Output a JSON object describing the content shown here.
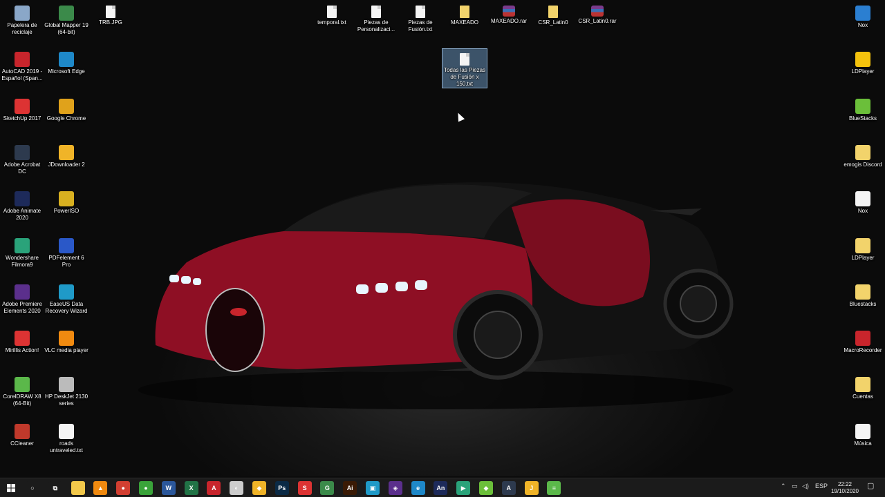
{
  "desktop": {
    "left_col1": [
      {
        "label": "Papelera de reciclaje",
        "icon": "recycle-bin-icon",
        "color": "#8aa7c8"
      },
      {
        "label": "AutoCAD 2019 - Español (Span...",
        "icon": "autocad-icon",
        "color": "#c8252c"
      },
      {
        "label": "SketchUp 2017",
        "icon": "sketchup-icon",
        "color": "#d33"
      },
      {
        "label": "Adobe Acrobat DC",
        "icon": "acrobat-icon",
        "color": "#2d3a4e"
      },
      {
        "label": "Adobe Animate 2020",
        "icon": "animate-icon",
        "color": "#1d2a5a"
      },
      {
        "label": "Wondershare Filmora9",
        "icon": "filmora-icon",
        "color": "#2aa37a"
      },
      {
        "label": "Adobe Premiere Elements 2020",
        "icon": "premiere-icon",
        "color": "#5b2f8c"
      },
      {
        "label": "Mirillis Action!",
        "icon": "action-icon",
        "color": "#d33"
      },
      {
        "label": "CorelDRAW X8 (64-Bit)",
        "icon": "coreldraw-icon",
        "color": "#5bb84a"
      },
      {
        "label": "CCleaner",
        "icon": "ccleaner-icon",
        "color": "#c0392b"
      }
    ],
    "left_col2": [
      {
        "label": "Global Mapper 19 (64-bit)",
        "icon": "global-mapper-icon",
        "color": "#3b8a4a"
      },
      {
        "label": "Microsoft Edge",
        "icon": "edge-icon",
        "color": "#1e88c8"
      },
      {
        "label": "Google Chrome",
        "icon": "chrome-icon",
        "color": "#e0a21b"
      },
      {
        "label": "JDownloader 2",
        "icon": "jdownloader-icon",
        "color": "#f0b428"
      },
      {
        "label": "PowerISO",
        "icon": "poweriso-icon",
        "color": "#d8b020"
      },
      {
        "label": "PDFelement 6 Pro",
        "icon": "pdfelement-icon",
        "color": "#2a58c8"
      },
      {
        "label": "EaseUS Data Recovery Wizard",
        "icon": "easeus-icon",
        "color": "#1f9ac8"
      },
      {
        "label": "VLC media player",
        "icon": "vlc-icon",
        "color": "#f08a10"
      },
      {
        "label": "HP DeskJet 2130 series",
        "icon": "printer-icon",
        "color": "#bbbbbb"
      },
      {
        "label": "roads untraveled.txt",
        "icon": "text-file-icon",
        "color": "#f4f4f4"
      }
    ],
    "top_files": [
      {
        "label": "TRB.JPG",
        "icon": "image-file-icon",
        "kind": "file"
      },
      {
        "label": "temporal.txt",
        "icon": "text-file-icon",
        "kind": "file"
      },
      {
        "label": "Piezas de Personalizaci...",
        "icon": "text-file-icon",
        "kind": "file"
      },
      {
        "label": "Piezas de Fusión.txt",
        "icon": "text-file-icon",
        "kind": "file"
      },
      {
        "label": "MAXEADO",
        "icon": "folder-icon",
        "kind": "folder"
      },
      {
        "label": "MAXEADO.rar",
        "icon": "rar-archive-icon",
        "kind": "rar"
      },
      {
        "label": "CSR_Latin0",
        "icon": "folder-icon",
        "kind": "folder"
      },
      {
        "label": "CSR_Latin0.rar",
        "icon": "rar-archive-icon",
        "kind": "rar"
      }
    ],
    "selected_file": {
      "label": "Todas las Piezas de Fusión x 150.txt",
      "icon": "text-file-icon"
    },
    "right_col": [
      {
        "label": "Nox",
        "icon": "nox-icon",
        "color": "#2b7fd1"
      },
      {
        "label": "LDPlayer",
        "icon": "ldplayer-icon",
        "color": "#f4c20d"
      },
      {
        "label": "BlueStacks",
        "icon": "bluestacks-icon",
        "color": "#6bbf3a"
      },
      {
        "label": "emogis Discord",
        "icon": "folder-icon",
        "color": "#f2d36b"
      },
      {
        "label": "Nox",
        "icon": "nox-shortcut-icon",
        "color": "#f4f4f4"
      },
      {
        "label": "LDPlayer",
        "icon": "ldplayer-shortcut-icon",
        "color": "#f2d36b"
      },
      {
        "label": "Bluestacks",
        "icon": "bluestacks-shortcut-icon",
        "color": "#f2d36b"
      },
      {
        "label": "MacroRecorder",
        "icon": "macrorecorder-icon",
        "color": "#c8252c"
      },
      {
        "label": "Cuentas",
        "icon": "folder-icon",
        "color": "#f2d36b"
      },
      {
        "label": "Música",
        "icon": "music-file-icon",
        "color": "#f4f4f4"
      }
    ]
  },
  "taskbar": {
    "start_icon": "windows-start-icon",
    "pinned": [
      {
        "name": "cortana-icon",
        "text": "○",
        "color": "#1b1b1b"
      },
      {
        "name": "task-view-icon",
        "text": "⧉",
        "color": "#1b1b1b"
      },
      {
        "name": "file-explorer-icon",
        "text": "",
        "color": "#f2c84b"
      },
      {
        "name": "vlc-icon",
        "text": "▲",
        "color": "#f08a10"
      },
      {
        "name": "chrome-icon",
        "text": "●",
        "color": "#d23f31"
      },
      {
        "name": "green-app-icon",
        "text": "●",
        "color": "#3aa33a"
      },
      {
        "name": "word-icon",
        "text": "W",
        "color": "#2b579a"
      },
      {
        "name": "excel-icon",
        "text": "X",
        "color": "#217346"
      },
      {
        "name": "autocad-icon",
        "text": "A",
        "color": "#c8252c"
      },
      {
        "name": "globe-app-icon",
        "text": "◐",
        "color": "#cccccc"
      },
      {
        "name": "yellow-app-icon",
        "text": "◆",
        "color": "#f0b428"
      },
      {
        "name": "photoshop-icon",
        "text": "Ps",
        "color": "#0b2a45"
      },
      {
        "name": "sketchup-icon",
        "text": "S",
        "color": "#d33"
      },
      {
        "name": "global-mapper-icon",
        "text": "G",
        "color": "#3b8a4a"
      },
      {
        "name": "illustrator-icon",
        "text": "Ai",
        "color": "#3a1a05"
      },
      {
        "name": "image-app-icon",
        "text": "▣",
        "color": "#1f9ac8"
      },
      {
        "name": "premiere-icon",
        "text": "◈",
        "color": "#5b2f8c"
      },
      {
        "name": "edge-icon",
        "text": "e",
        "color": "#1e88c8"
      },
      {
        "name": "animate-icon",
        "text": "An",
        "color": "#1d2a5a"
      },
      {
        "name": "filmora-icon",
        "text": "▶",
        "color": "#2aa37a"
      },
      {
        "name": "bluestacks-icon",
        "text": "◆",
        "color": "#6bbf3a"
      },
      {
        "name": "acrobat-icon",
        "text": "A",
        "color": "#2d3a4e"
      },
      {
        "name": "jdownloader-icon",
        "text": "J",
        "color": "#f0b428"
      },
      {
        "name": "notepad-icon",
        "text": "≡",
        "color": "#5bb84a"
      }
    ],
    "tray": {
      "chevron": "⌃",
      "network": "▭",
      "volume": "◁)",
      "language": "ESP",
      "time": "22:22",
      "date": "19/10/2020",
      "notification": "▢"
    }
  }
}
